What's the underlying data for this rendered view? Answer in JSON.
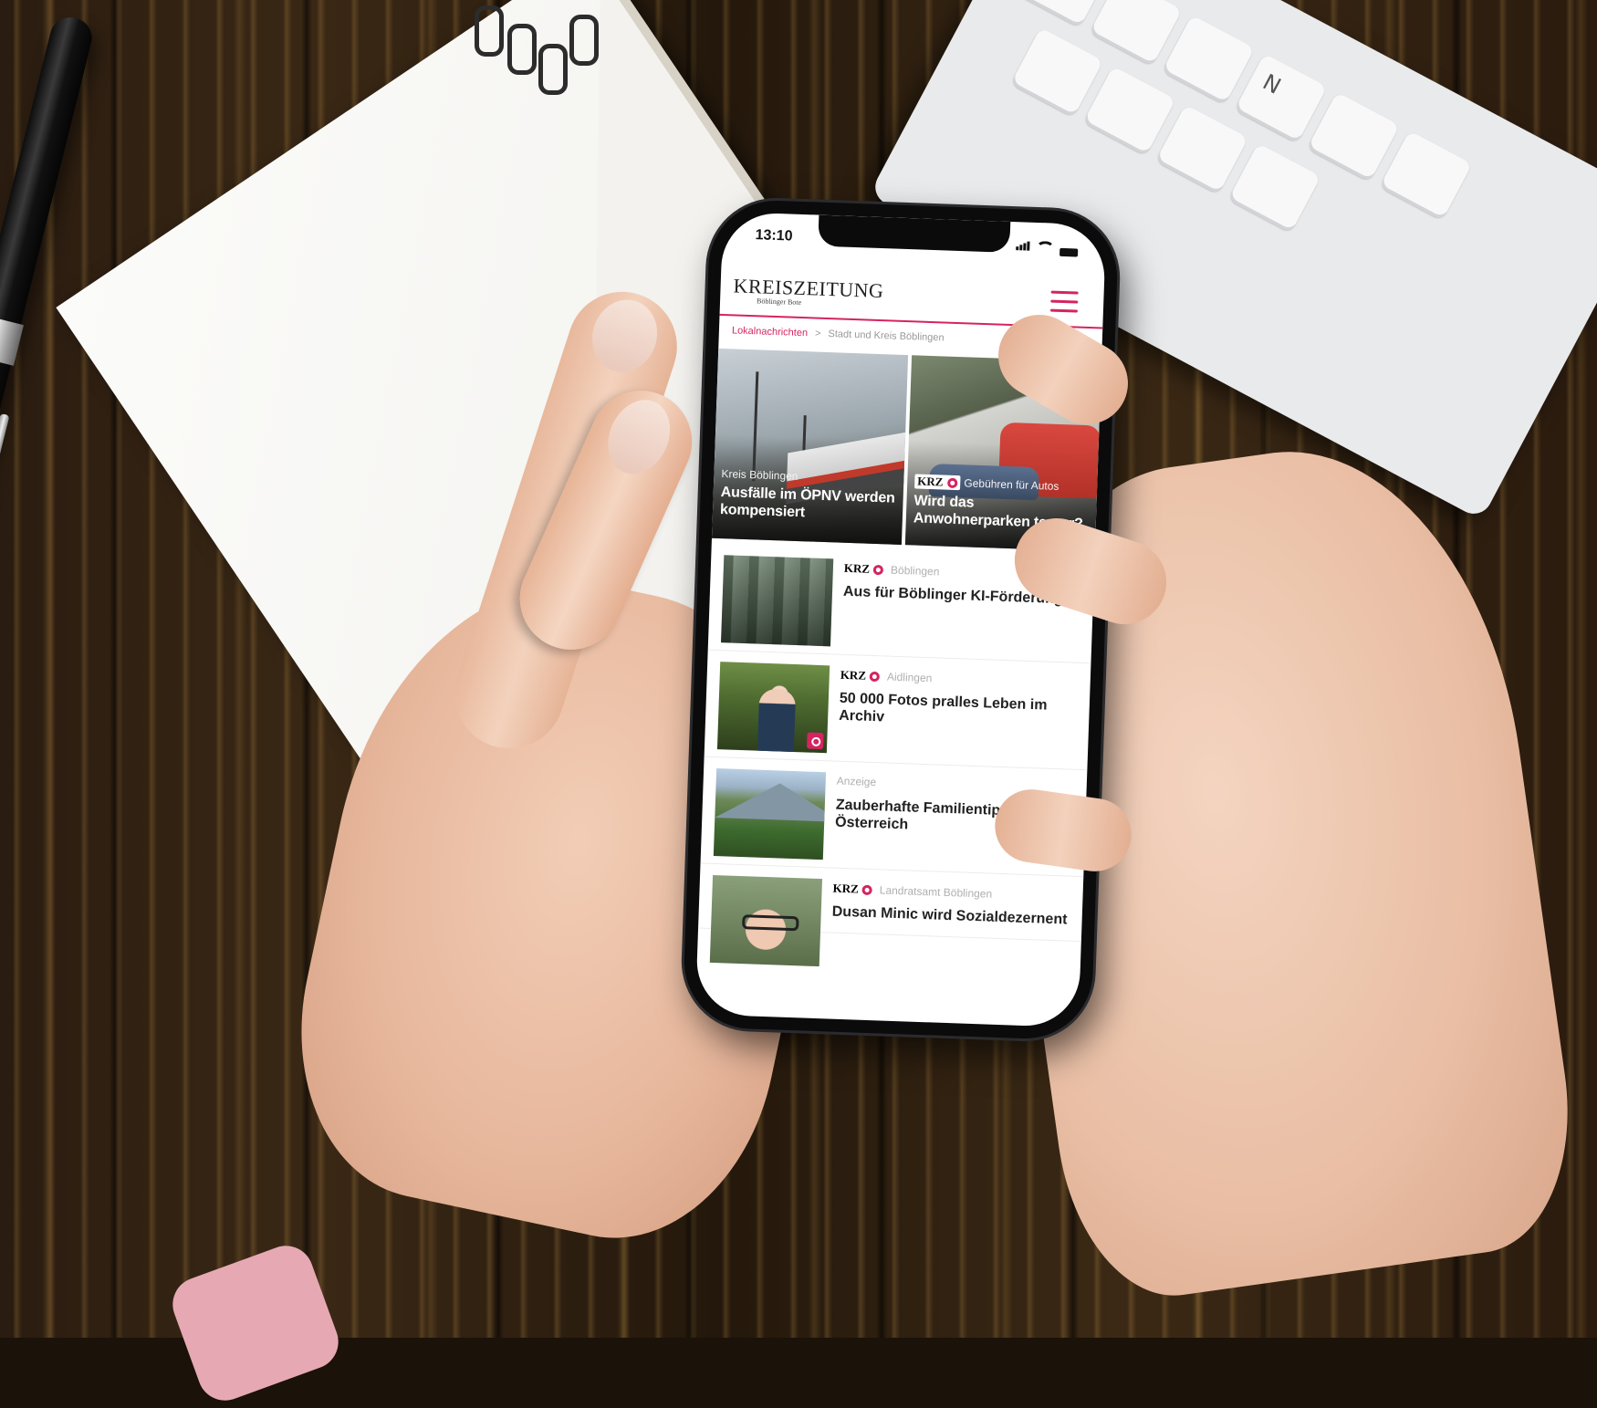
{
  "status_bar": {
    "time": "13:10"
  },
  "app": {
    "logo": "KREISZEITUNG",
    "logo_sub": "Böblinger Bote",
    "menu_icon": "hamburger-menu-icon",
    "accent_color": "#d5245f"
  },
  "breadcrumb": {
    "items": [
      "Lokalnachrichten",
      "Stadt und Kreis Böblingen"
    ],
    "separator": ">"
  },
  "hero": [
    {
      "kicker": "Kreis Böblingen",
      "title": "Ausfälle im ÖPNV werden kompensiert"
    },
    {
      "badge": "KRZ",
      "kicker": "Gebühren für Autos",
      "title": "Wird das Anwohnerparken teurer?"
    }
  ],
  "articles": [
    {
      "badge": "KRZ",
      "location": "Böblingen",
      "title": "Aus für Böblinger KI-Förderung"
    },
    {
      "badge": "KRZ",
      "location": "Aidlingen",
      "title": "50 000 Fotos pralles Leben im Archiv",
      "media_icon": "camera-icon"
    },
    {
      "badge": "",
      "location": "Anzeige",
      "title": "Zauberhafte Familientipps in Österreich"
    },
    {
      "badge": "KRZ",
      "location": "Landratsamt Böblingen",
      "title": "Dusan Minic wird Sozialdezernent"
    }
  ],
  "scene": {
    "keyboard_key": "N"
  }
}
